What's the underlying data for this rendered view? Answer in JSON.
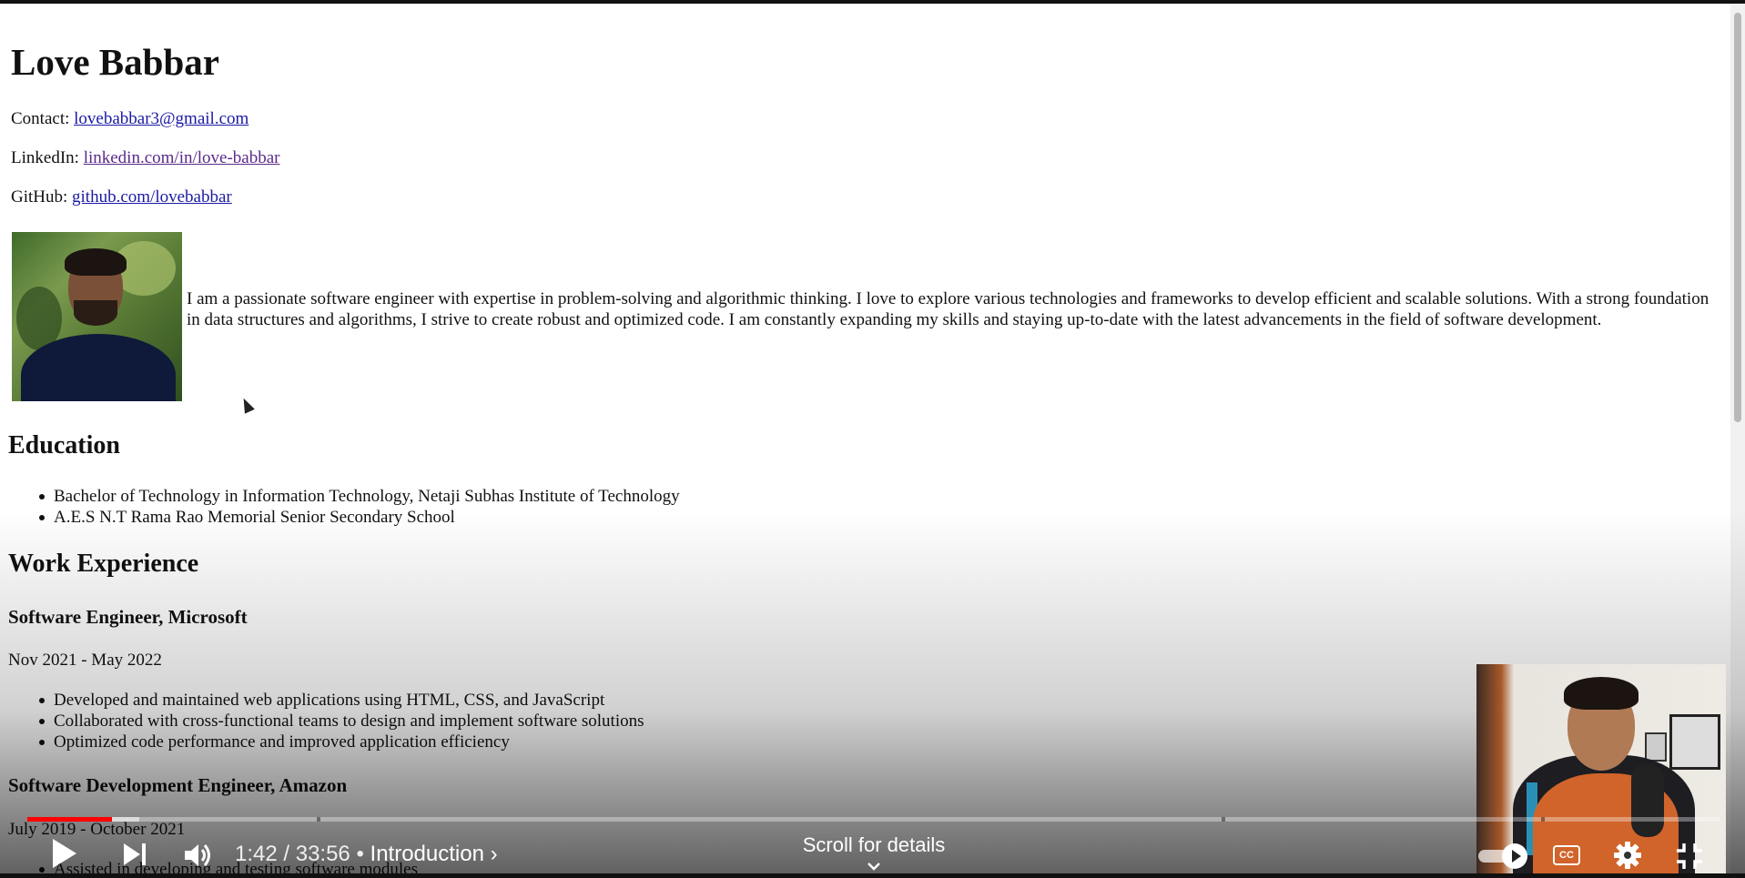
{
  "resume": {
    "name": "Love Babbar",
    "contact_label": "Contact:",
    "contact_email": "lovebabbar3@gmail.com",
    "linkedin_label": "LinkedIn:",
    "linkedin_url_text": "linkedin.com/in/love-babbar",
    "github_label": "GitHub:",
    "github_url_text": "github.com/lovebabbar",
    "about": "I am a passionate software engineer with expertise in problem-solving and algorithmic thinking. I love to explore various technologies and frameworks to develop efficient and scalable solutions. With a strong foundation in data structures and algorithms, I strive to create robust and optimized code. I am constantly expanding my skills and staying up-to-date with the latest advancements in the field of software development.",
    "education_heading": "Education",
    "education": [
      "Bachelor of Technology in Information Technology, Netaji Subhas Institute of Technology",
      "A.E.S N.T Rama Rao Memorial Senior Secondary School"
    ],
    "work_heading": "Work Experience",
    "jobs": [
      {
        "title": "Software Engineer, Microsoft",
        "dates": "Nov 2021 - May 2022",
        "bullets": [
          "Developed and maintained web applications using HTML, CSS, and JavaScript",
          "Collaborated with cross-functional teams to design and implement software solutions",
          "Optimized code performance and improved application efficiency"
        ]
      },
      {
        "title": "Software Development Engineer, Amazon",
        "dates": "July 2019 - October 2021",
        "bullets": [
          "Assisted in developing and testing software modules"
        ]
      }
    ]
  },
  "player": {
    "time": "1:42 / 33:56",
    "separator": "•",
    "chapter": "Introduction",
    "chapter_chevron": "›",
    "scroll_hint": "Scroll for details",
    "cc_label": "CC",
    "progress_played_fraction": 0.05,
    "progress_loaded_fraction": 0.066,
    "accent_color": "#ff0000",
    "icons": [
      "play-icon",
      "next-icon",
      "volume-icon",
      "autoplay-toggle-icon",
      "captions-icon",
      "settings-gear-icon",
      "exit-fullscreen-icon",
      "chevron-down-icon"
    ]
  }
}
